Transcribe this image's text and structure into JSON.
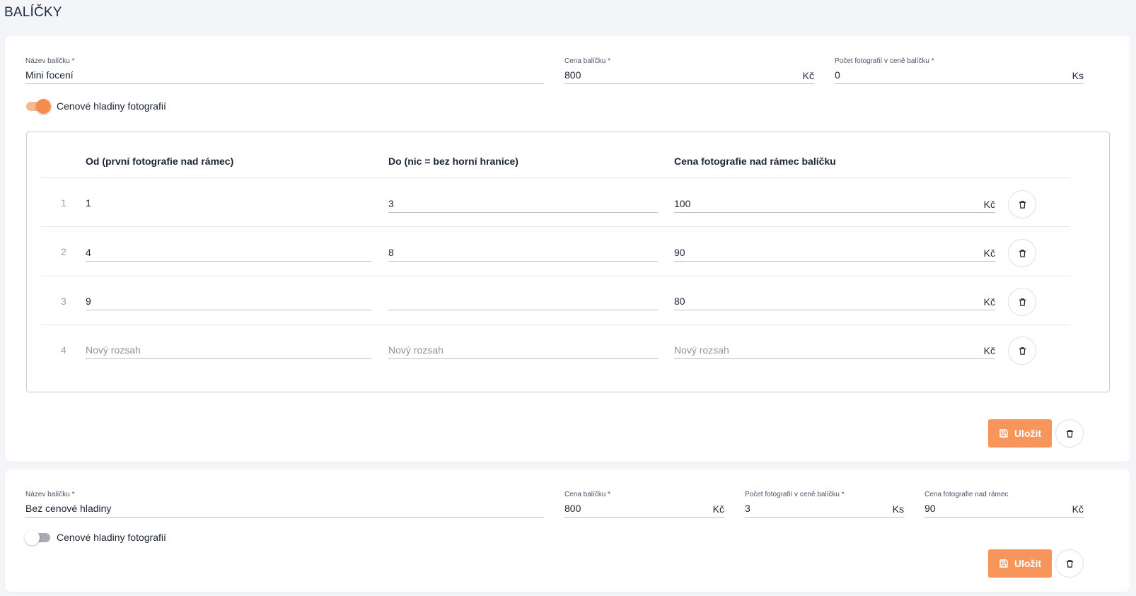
{
  "page": {
    "title": "BALÍČKY"
  },
  "package1": {
    "name": {
      "label": "Název balíčku *",
      "value": "Mini focení"
    },
    "price": {
      "label": "Cena balíčku *",
      "value": "800",
      "unit": "Kč"
    },
    "photo_count": {
      "label": "Počet fotografií v ceně balíčku *",
      "value": "0",
      "unit": "Ks"
    },
    "tiers_toggle": {
      "label": "Cenové hladiny fotografií",
      "enabled": true
    },
    "tiers": {
      "headers": {
        "from": "Od (první fotografie nad rámec)",
        "to": "Do (nic = bez horní hranice)",
        "price": "Cena fotografie nad rámec balíčku"
      },
      "unit": "Kč",
      "placeholder": "Nový rozsah",
      "rows": [
        {
          "num": "1",
          "from": "1",
          "to": "3",
          "price": "100"
        },
        {
          "num": "2",
          "from": "4",
          "to": "8",
          "price": "90"
        },
        {
          "num": "3",
          "from": "9",
          "to": "",
          "price": "80"
        },
        {
          "num": "4",
          "from": "",
          "to": "",
          "price": ""
        }
      ]
    },
    "save_label": "Uložit"
  },
  "package2": {
    "name": {
      "label": "Název balíčku *",
      "value": "Bez cenové hladiny"
    },
    "price": {
      "label": "Cena balíčku *",
      "value": "800",
      "unit": "Kč"
    },
    "photo_count": {
      "label": "Počet fotografií v ceně balíčku *",
      "value": "3",
      "unit": "Ks"
    },
    "extra_price": {
      "label": "Cena fotografie nad rámec",
      "value": "90",
      "unit": "Kč"
    },
    "tiers_toggle": {
      "label": "Cenové hladiny fotografií",
      "enabled": false
    },
    "save_label": "Uložit"
  },
  "colors": {
    "accent": "#f7955a",
    "toggle_on": "#f58b4c",
    "text": "#1a2433"
  },
  "icons": {
    "delete": "trash-icon",
    "save": "floppy-disk-icon"
  }
}
